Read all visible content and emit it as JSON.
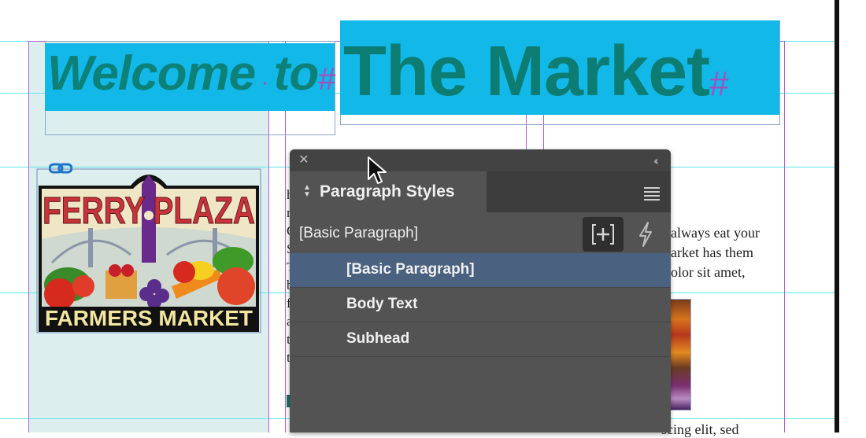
{
  "document": {
    "headline_part1": "Welcome",
    "headline_part2": "to",
    "headline_big": "The Market",
    "logo": {
      "top_text": "FERRY PLAZA",
      "bottom_text": "FARMERS MARKET"
    },
    "middle_column_fragments": [
      "h",
      "n",
      "C",
      "S",
      "T",
      "b",
      "f",
      "a",
      "t",
      "t"
    ],
    "right_column_lines": [
      "always eat your",
      "arket has them",
      "olor sit amet,"
    ],
    "bottom_right_text": "scing elit, sed"
  },
  "panel": {
    "title": "Paragraph Styles",
    "current_style": "[Basic Paragraph]",
    "styles": [
      {
        "label": "[Basic Paragraph]",
        "selected": true
      },
      {
        "label": "Body Text",
        "selected": false
      },
      {
        "label": "Subhead",
        "selected": false
      }
    ],
    "icons": {
      "close": "close-icon",
      "collapse": "collapse-panel-icon",
      "menu": "panel-menu-icon",
      "new_style": "create-new-style-icon",
      "quick_apply": "lightning-icon",
      "tab_arrows": "expand-collapse-arrows-icon"
    }
  },
  "colors": {
    "accent_cyan": "#11b8e8",
    "headline_teal": "#0d7c72",
    "selection_blue": "#4a6280",
    "panel_bg": "#535353"
  }
}
